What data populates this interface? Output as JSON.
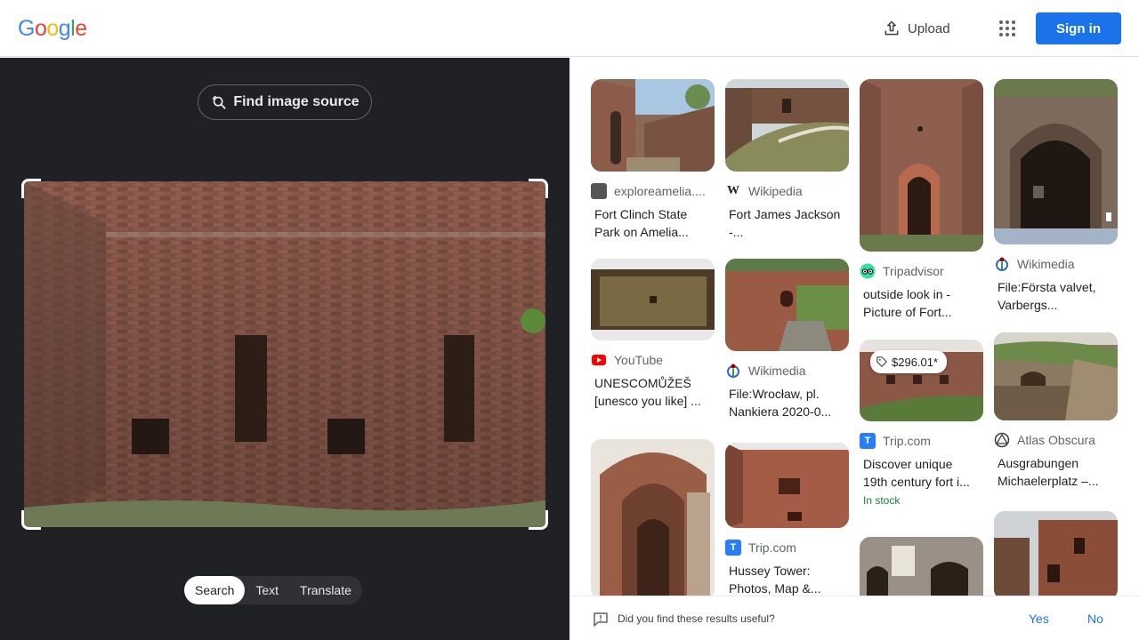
{
  "header": {
    "logo_letters": [
      {
        "ch": "G",
        "color": "#4285F4"
      },
      {
        "ch": "o",
        "color": "#EA4335"
      },
      {
        "ch": "o",
        "color": "#FBBC05"
      },
      {
        "ch": "g",
        "color": "#4285F4"
      },
      {
        "ch": "l",
        "color": "#34A853"
      },
      {
        "ch": "e",
        "color": "#EA4335"
      }
    ],
    "upload_label": "Upload",
    "signin_label": "Sign in",
    "apps_icon": "apps-grid-icon"
  },
  "lens": {
    "find_source_label": "Find image source",
    "tabs": [
      {
        "label": "Search",
        "active": true
      },
      {
        "label": "Text",
        "active": false
      },
      {
        "label": "Translate",
        "active": false
      }
    ]
  },
  "results": [
    {
      "source": "exploreamelia....",
      "title": "Fort Clinch State Park on Amelia...",
      "icon": "exploreamelia-favicon"
    },
    {
      "source": "Wikipedia",
      "title": "Fort James Jackson -...",
      "icon": "wikipedia-favicon"
    },
    {
      "source": "Tripadvisor",
      "title": "outside look in - Picture of Fort...",
      "icon": "tripadvisor-favicon"
    },
    {
      "source": "Wikimedia",
      "title": "File:Första valvet, Varbergs...",
      "icon": "wikimedia-favicon"
    },
    {
      "source": "YouTube",
      "title": "UNESCOMŮŽEŠ [unesco you like] ...",
      "icon": "youtube-favicon"
    },
    {
      "source": "Wikimedia",
      "title": "File:Wrocław, pl. Nankiera 2020-0...",
      "icon": "wikimedia-favicon"
    },
    {
      "source": "Trip.com",
      "title": "Discover unique 19th century fort i...",
      "icon": "tripcom-favicon",
      "price": "$296.01*",
      "stock": "In stock"
    },
    {
      "source": "Atlas Obscura",
      "title": "Ausgrabungen Michaelerplatz –...",
      "icon": "atlas-obscura-favicon"
    },
    {
      "source": "Trip.com",
      "title": "Hussey Tower: Photos, Map &...",
      "icon": "tripcom-favicon"
    }
  ],
  "feedback": {
    "question": "Did you find these results useful?",
    "yes": "Yes",
    "no": "No"
  }
}
